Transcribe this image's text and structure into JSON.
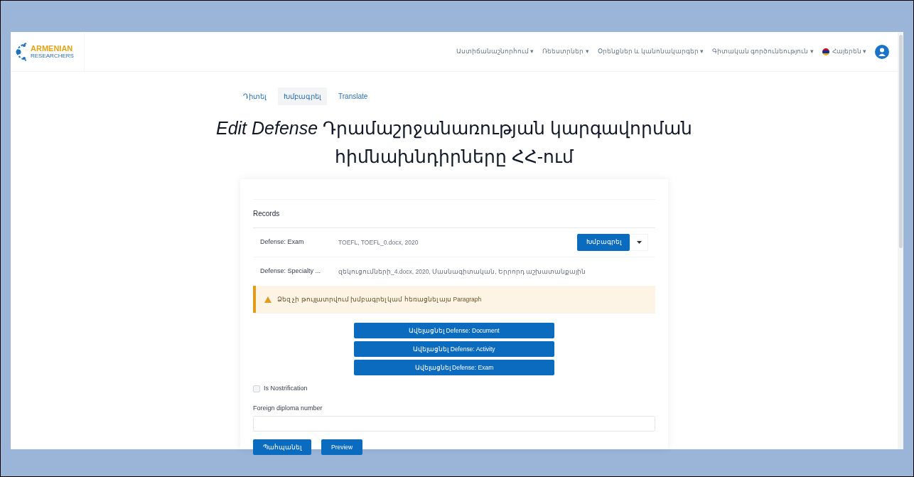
{
  "header": {
    "logo_text": "ARMENIAN",
    "logo_subtext": "RESEARCHERS",
    "nav": [
      {
        "label": "Աստիճանաշնորհում",
        "caret": "▾"
      },
      {
        "label": "Ռեեստրներ",
        "caret": "▾"
      },
      {
        "label": "Օրենքներ և կանոնակարգեր",
        "caret": "▾"
      },
      {
        "label": "Գիտական գործունեություն",
        "caret": "▾"
      },
      {
        "label": "Հայերեն",
        "caret": "▾",
        "kind": "language"
      }
    ]
  },
  "tabs": [
    {
      "label": "Դիտել",
      "selected": false
    },
    {
      "label": "Խմբագրել",
      "selected": true
    },
    {
      "label": "Translate",
      "selected": false
    }
  ],
  "title": "*Edit Defense* Դրամաշրջանառության կարգավորման հիմնախնդիրները ՀՀ-ում",
  "records": {
    "heading": "Records",
    "items": [
      {
        "type": "Defense: Exam",
        "summary": "TOEFL, TOEFL_0.docx, 2020",
        "button": "Խմբագրել"
      },
      {
        "type": "Defense: Specialty ...",
        "summary": "զեկուցումների_4.docx, 2020, Մասնագիտական, Երրորդ աշխատանքային",
        "warning": "Ձեզ չի թույլատրվում խմբագրել կամ հեռացնել այս Paragraph"
      }
    ]
  },
  "add_buttons": [
    "Ավելացնել Defense: Document",
    "Ավելացնել Defense: Activity",
    "Ավելացնել Defense: Exam"
  ],
  "notification": {
    "label": "Is Nostrification",
    "checked": false
  },
  "diploma_field": {
    "label": "Foreign diploma number"
  },
  "actions": [
    "Պահպանել",
    "Preview"
  ]
}
